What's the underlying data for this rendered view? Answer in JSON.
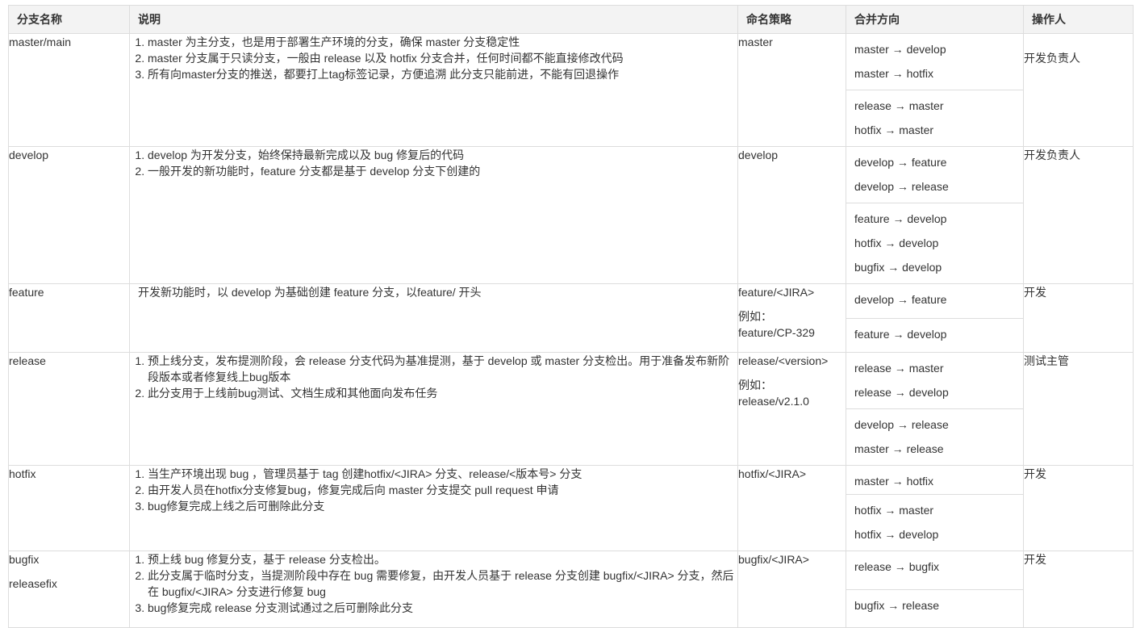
{
  "headers": {
    "name": "分支名称",
    "description": "说明",
    "naming": "命名策略",
    "merge": "合并方向",
    "operator": "操作人"
  },
  "rows": [
    {
      "names": [
        "master/main"
      ],
      "description": [
        "master 为主分支，也是用于部署生产环境的分支，确保 master 分支稳定性",
        "master 分支属于只读分支，一般由 release 以及 hotfix 分支合并，任何时间都不能直接修改代码",
        "所有向master分支的推送，都要打上tag标签记录，方便追溯 此分支只能前进，不能有回退操作"
      ],
      "naming": [
        "master"
      ],
      "merge_groups": [
        [
          "master → develop",
          "master → hotfix"
        ],
        [
          "release → master",
          "hotfix → master"
        ]
      ],
      "operator": "开发负责人"
    },
    {
      "names": [
        "develop"
      ],
      "description": [
        "develop 为开发分支，始终保持最新完成以及 bug 修复后的代码",
        "一般开发的新功能时，feature 分支都是基于 develop 分支下创建的"
      ],
      "naming": [
        "develop"
      ],
      "merge_groups": [
        [
          "develop → feature",
          "develop → release"
        ],
        [
          "feature → develop",
          "hotfix → develop",
          "bugfix → develop"
        ]
      ],
      "operator": "开发负责人"
    },
    {
      "names": [
        "feature"
      ],
      "description_text": "开发新功能时，以 develop 为基础创建 feature 分支，以feature/ 开头",
      "naming": [
        "feature/<JIRA>",
        "例如：",
        "feature/CP-329"
      ],
      "merge_groups": [
        [
          "develop → feature"
        ],
        [
          "feature → develop"
        ]
      ],
      "operator": "开发"
    },
    {
      "names": [
        "release"
      ],
      "description": [
        "预上线分支，发布提测阶段，会 release 分支代码为基准提测，基于 develop 或 master 分支检出。用于准备发布新阶段版本或者修复线上bug版本",
        "此分支用于上线前bug测试、文档生成和其他面向发布任务"
      ],
      "naming": [
        "release/<version>",
        "例如：",
        "release/v2.1.0"
      ],
      "merge_groups": [
        [
          "release → master",
          "release → develop"
        ],
        [
          "develop → release",
          "master → release"
        ]
      ],
      "operator": "测试主管"
    },
    {
      "names": [
        "hotfix"
      ],
      "description": [
        "当生产环境出现 bug ，管理员基于 tag 创建hotfix/<JIRA> 分支、release/<版本号> 分支",
        "由开发人员在hotfix分支修复bug，修复完成后向 master 分支提交 pull request 申请",
        "bug修复完成上线之后可删除此分支"
      ],
      "naming": [
        "hotfix/<JIRA>"
      ],
      "merge_groups": [
        [
          "master → hotfix"
        ],
        [
          "hotfix → master",
          "hotfix → develop"
        ]
      ],
      "operator": "开发"
    },
    {
      "names": [
        "bugfix",
        "releasefix"
      ],
      "description": [
        "预上线 bug 修复分支，基于 release 分支检出。",
        "此分支属于临时分支，当提测阶段中存在 bug 需要修复，由开发人员基于 release 分支创建 bugfix/<JIRA> 分支，然后在 bugfix/<JIRA> 分支进行修复 bug",
        "bug修复完成 release 分支测试通过之后可删除此分支"
      ],
      "naming": [
        "bugfix/<JIRA>"
      ],
      "merge_groups": [
        [
          "release → bugfix"
        ],
        [
          "bugfix → release"
        ]
      ],
      "operator": "开发"
    }
  ]
}
